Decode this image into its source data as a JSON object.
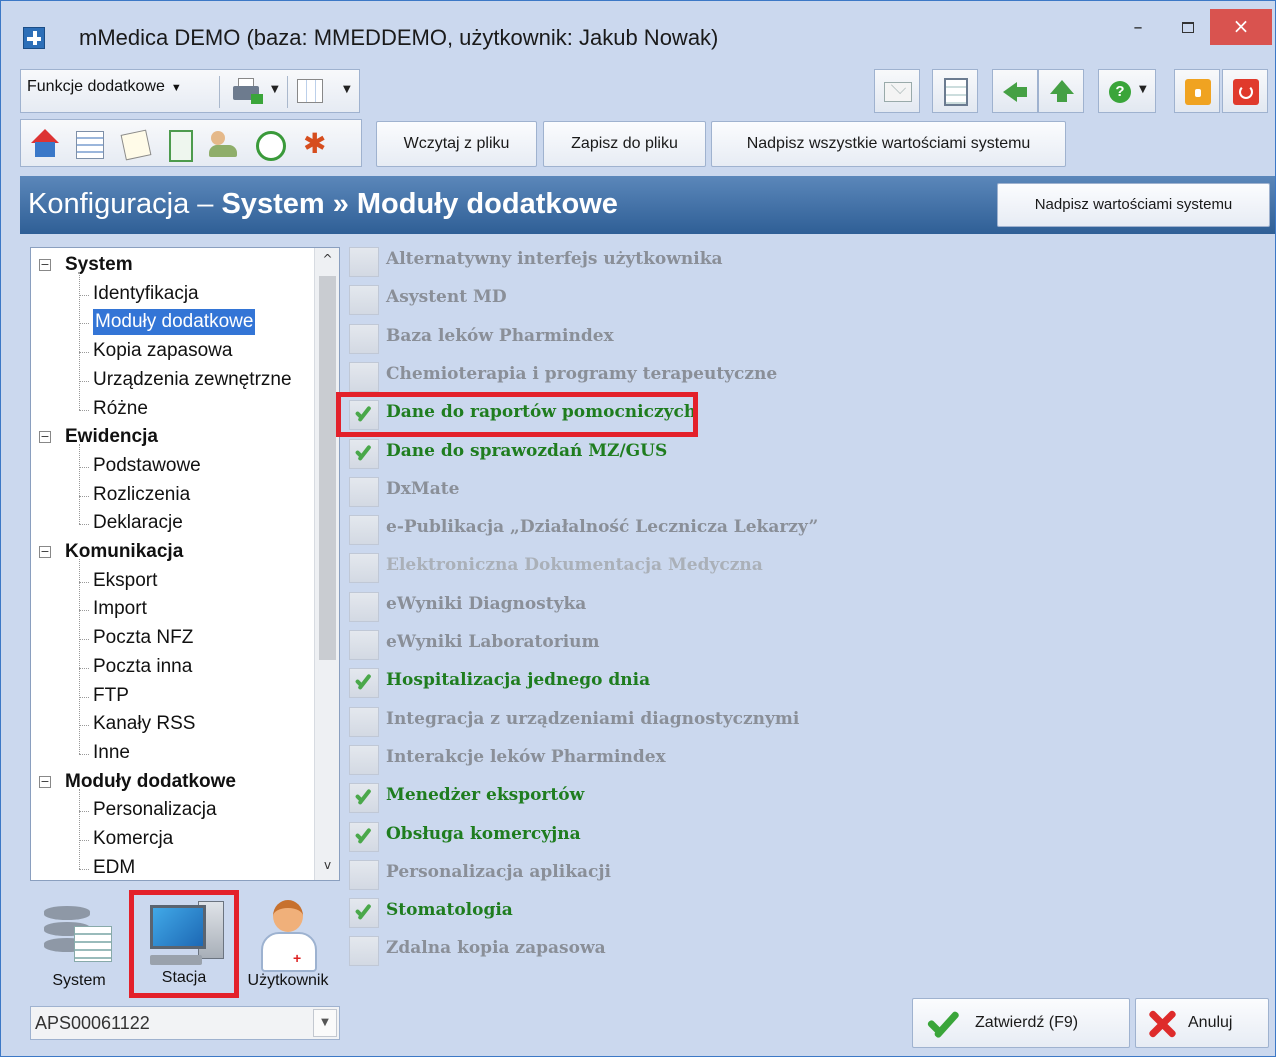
{
  "window": {
    "title": "mMedica DEMO  (baza: MMEDDEMO, użytkownik: Jakub Nowak)",
    "minimize": "–",
    "close": "×"
  },
  "toolbar": {
    "functions_label": "Funkcje dodatkowe",
    "load_label": "Wczytaj z pliku",
    "save_label": "Zapisz do pliku",
    "overwrite_all_label": "Nadpisz wszystkie wartościami systemu"
  },
  "header": {
    "prefix": "Konfiguracja – ",
    "section": "System",
    "separator": " » ",
    "page": "Moduły dodatkowe",
    "overwrite_label": "Nadpisz wartościami systemu",
    "colors": {
      "band_top": "#5b87ba",
      "band_bottom": "#2f5f96"
    }
  },
  "tree": {
    "groups": [
      {
        "label": "System",
        "items": [
          "Identyfikacja",
          "Moduły dodatkowe",
          "Kopia zapasowa",
          "Urządzenia zewnętrzne",
          "Różne"
        ]
      },
      {
        "label": "Ewidencja",
        "items": [
          "Podstawowe",
          "Rozliczenia",
          "Deklaracje"
        ]
      },
      {
        "label": "Komunikacja",
        "items": [
          "Eksport",
          "Import",
          "Poczta NFZ",
          "Poczta inna",
          "FTP",
          "Kanały RSS",
          "Inne"
        ]
      },
      {
        "label": "Moduły dodatkowe",
        "items": [
          "Personalizacja",
          "Komercja",
          "EDM"
        ]
      }
    ],
    "selected": "Moduły dodatkowe",
    "expander": "−",
    "scroll_up": "^",
    "scroll_down": "v"
  },
  "scope": {
    "system_label": "System",
    "station_label": "Stacja",
    "user_label": "Użytkownik",
    "selected": "Stacja",
    "station_value": "APS00061122",
    "select_caret": "▼"
  },
  "modules": [
    {
      "label": "Alternatywny interfejs użytkownika",
      "checked": false,
      "state": "off"
    },
    {
      "label": "Asystent MD",
      "checked": false,
      "state": "off"
    },
    {
      "label": "Baza leków Pharmindex",
      "checked": false,
      "state": "off"
    },
    {
      "label": "Chemioterapia i programy terapeutyczne",
      "checked": false,
      "state": "off"
    },
    {
      "label": "Dane do raportów pomocniczych",
      "checked": true,
      "state": "on"
    },
    {
      "label": "Dane do sprawozdań MZ/GUS",
      "checked": true,
      "state": "on"
    },
    {
      "label": "DxMate",
      "checked": false,
      "state": "off"
    },
    {
      "label": "e-Publikacja „Działalność Lecznicza Lekarzy”",
      "checked": false,
      "state": "off"
    },
    {
      "label": "Elektroniczna Dokumentacja Medyczna",
      "checked": false,
      "state": "disabled"
    },
    {
      "label": "eWyniki Diagnostyka",
      "checked": false,
      "state": "off"
    },
    {
      "label": "eWyniki Laboratorium",
      "checked": false,
      "state": "off"
    },
    {
      "label": "Hospitalizacja jednego dnia",
      "checked": true,
      "state": "on"
    },
    {
      "label": "Integracja z urządzeniami diagnostycznymi",
      "checked": false,
      "state": "off"
    },
    {
      "label": "Interakcje leków Pharmindex",
      "checked": false,
      "state": "off"
    },
    {
      "label": "Menedżer eksportów",
      "checked": true,
      "state": "on"
    },
    {
      "label": "Obsługa komercyjna",
      "checked": true,
      "state": "on"
    },
    {
      "label": "Personalizacja aplikacji",
      "checked": false,
      "state": "off"
    },
    {
      "label": "Stomatologia",
      "checked": true,
      "state": "on"
    },
    {
      "label": "Zdalna kopia zapasowa",
      "checked": false,
      "state": "off"
    }
  ],
  "footer": {
    "confirm_label": "Zatwierdź (F9)",
    "cancel_label": "Anuluj"
  },
  "colors": {
    "window_bg": "#cbd8ee",
    "checked_text": "#1f7d1f",
    "unchecked_text": "#8a8f98",
    "highlight": "#e3202a",
    "tree_selection": "#3375d6"
  }
}
